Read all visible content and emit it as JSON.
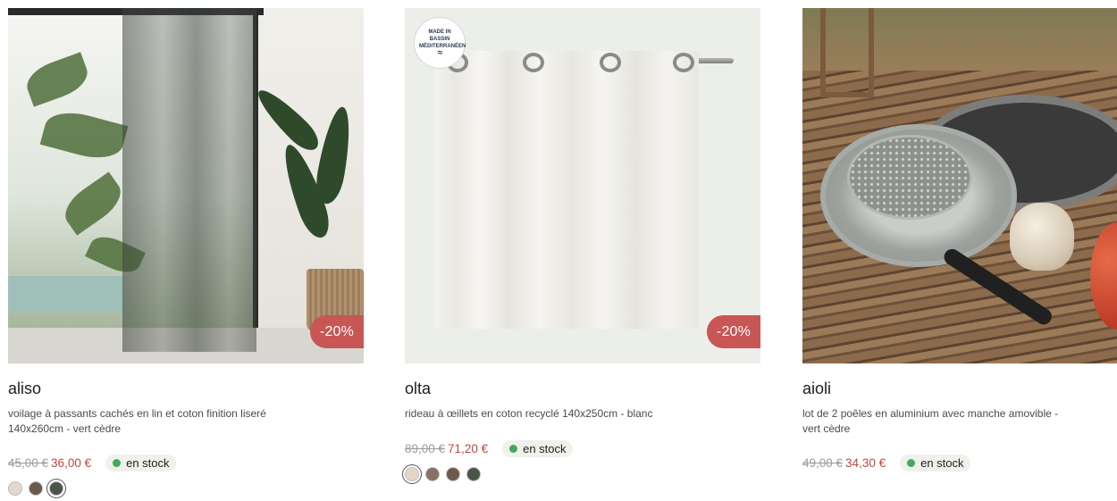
{
  "products": [
    {
      "name": "aliso",
      "description": "voilage à passants cachés en lin et coton finition liseré 140x260cm - vert cèdre",
      "discount": "-20%",
      "price_old": "45,00 €",
      "price_new": "36,00 €",
      "stock": "en stock",
      "swatches": [
        {
          "color": "#e3d8c9",
          "selected": false
        },
        {
          "color": "#6b5a4b",
          "selected": false
        },
        {
          "color": "#4a5648",
          "selected": true
        }
      ]
    },
    {
      "name": "olta",
      "description": "rideau à œillets en coton recyclé 140x250cm - blanc",
      "discount": "-20%",
      "stamp_text": "MADE IN BASSIN MÉDITERRANÉEN",
      "price_old": "89,00 €",
      "price_new": "71,20 €",
      "stock": "en stock",
      "swatches": [
        {
          "color": "#e5d7c8",
          "selected": true
        },
        {
          "color": "#8b6e66",
          "selected": false
        },
        {
          "color": "#6b5a4b",
          "selected": false
        },
        {
          "color": "#4a5648",
          "selected": false
        }
      ]
    },
    {
      "name": "aioli",
      "description": "lot de 2 poêles en aluminium avec manche amovible - vert cèdre",
      "price_old": "49,00 €",
      "price_new": "34,30 €",
      "stock": "en stock",
      "swatches": []
    }
  ],
  "colors": {
    "discount_badge": "#c85654",
    "price_new": "#c1463f",
    "stock_dot": "#3faa58",
    "stock_bg": "#eff1ea"
  }
}
